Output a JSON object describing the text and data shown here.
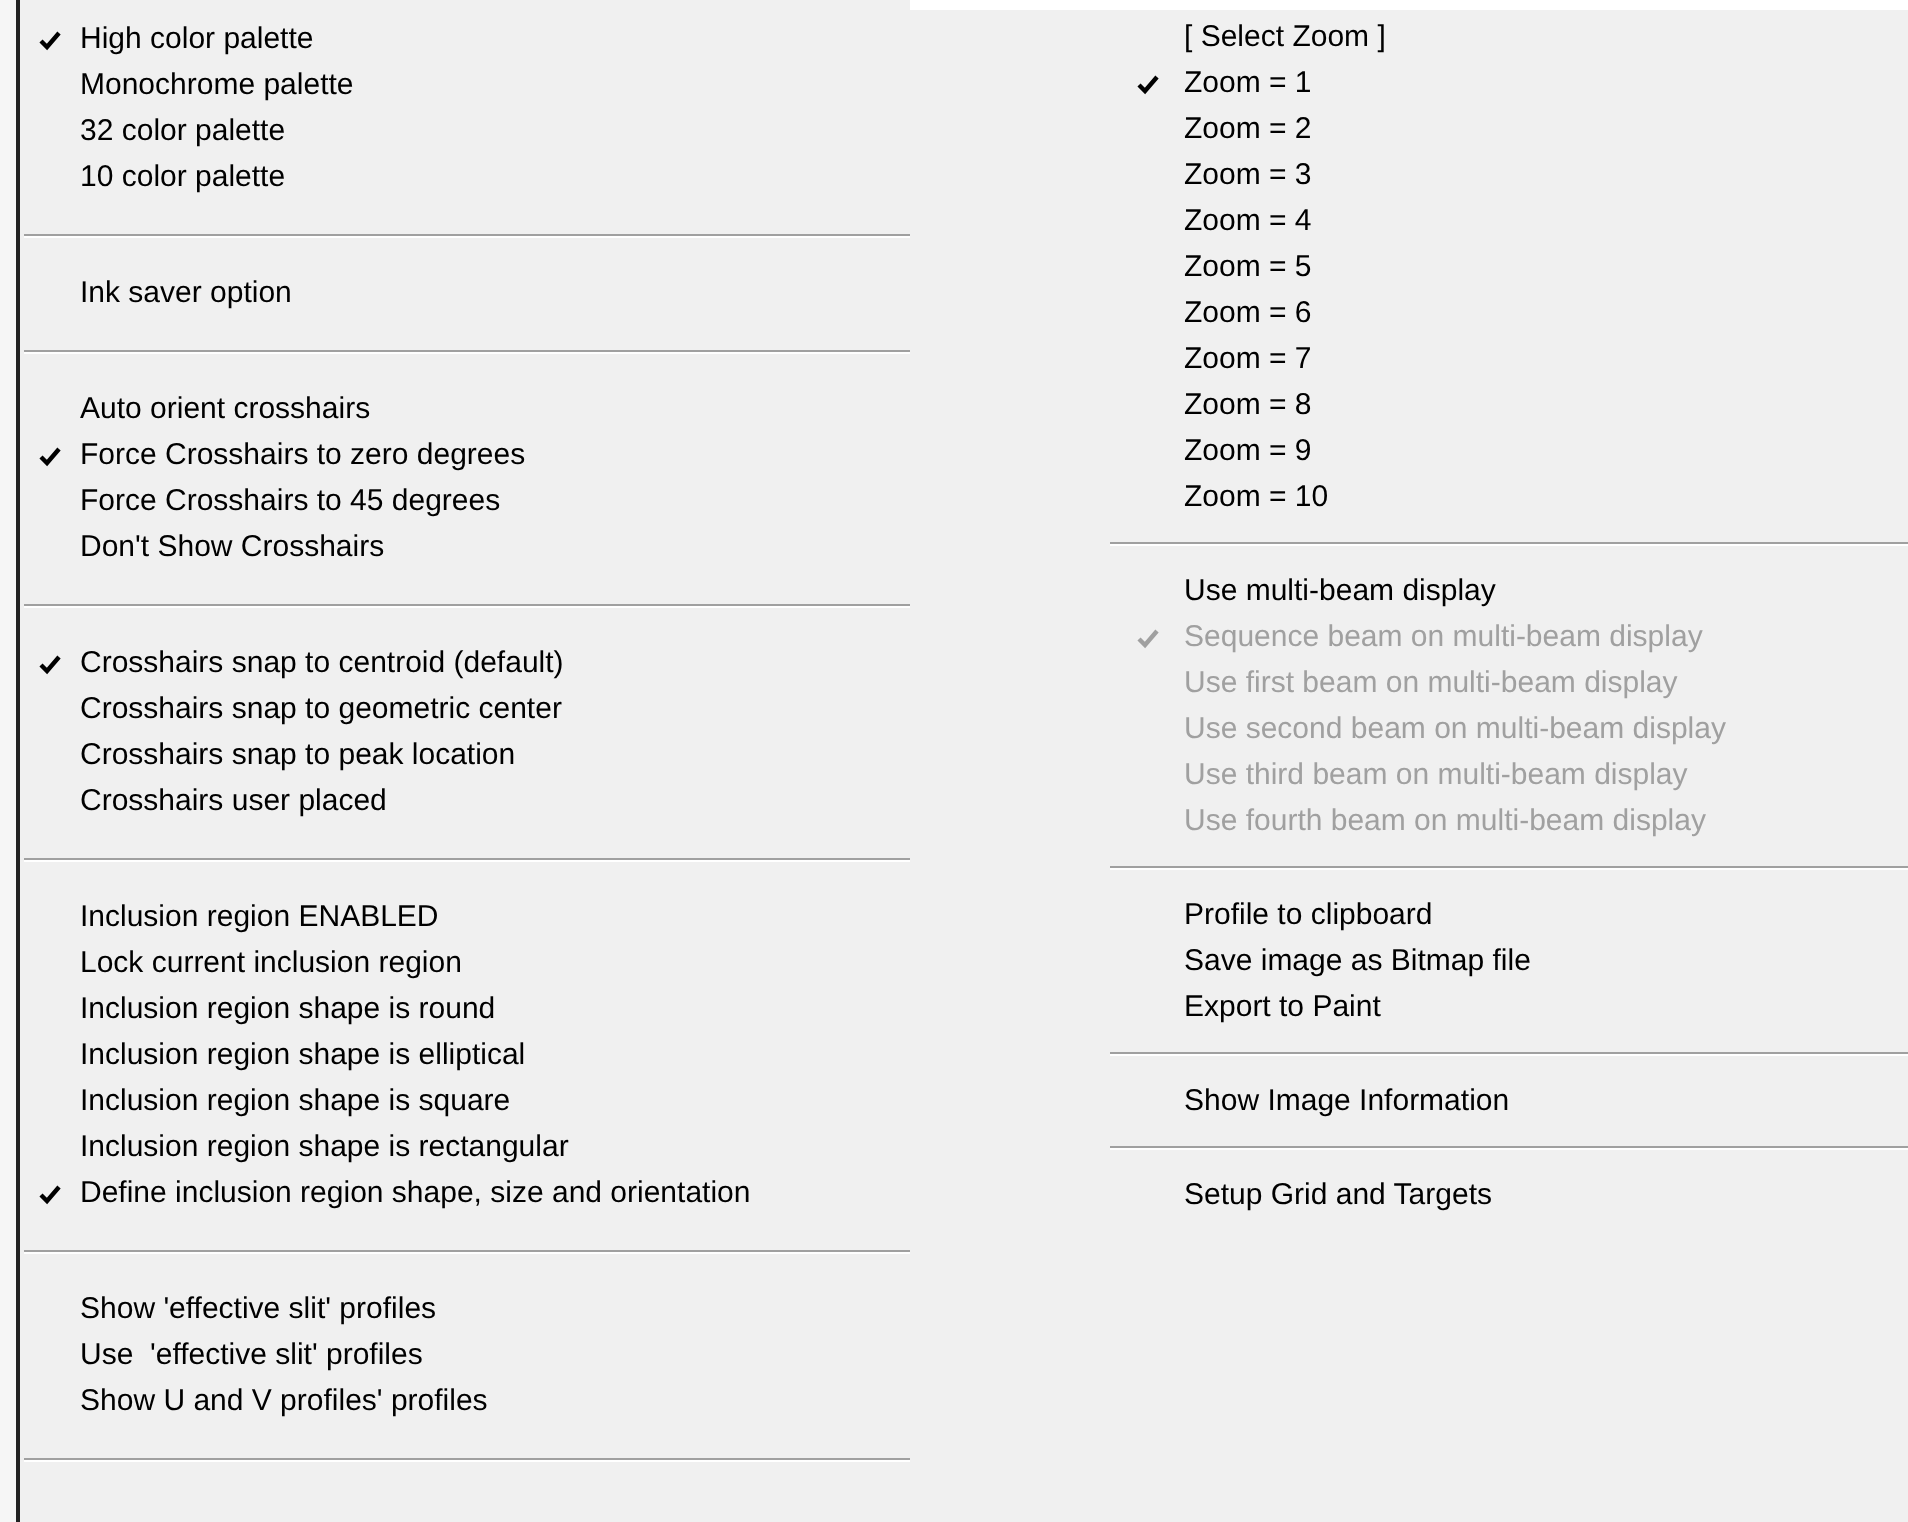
{
  "left_menu": {
    "sections": [
      {
        "items": [
          {
            "label": "High color palette",
            "checked": true,
            "disabled": false
          },
          {
            "label": "Monochrome palette",
            "checked": false,
            "disabled": false
          },
          {
            "label": "32 color palette",
            "checked": false,
            "disabled": false
          },
          {
            "label": "10 color palette",
            "checked": false,
            "disabled": false
          }
        ]
      },
      {
        "items": [
          {
            "label": "Ink saver option",
            "checked": false,
            "disabled": false
          }
        ]
      },
      {
        "items": [
          {
            "label": "Auto orient crosshairs",
            "checked": false,
            "disabled": false
          },
          {
            "label": "Force Crosshairs to zero degrees",
            "checked": true,
            "disabled": false
          },
          {
            "label": "Force Crosshairs to 45 degrees",
            "checked": false,
            "disabled": false
          },
          {
            "label": "Don't Show Crosshairs",
            "checked": false,
            "disabled": false
          }
        ]
      },
      {
        "items": [
          {
            "label": "Crosshairs snap to centroid (default)",
            "checked": true,
            "disabled": false
          },
          {
            "label": "Crosshairs snap to geometric center",
            "checked": false,
            "disabled": false
          },
          {
            "label": "Crosshairs snap to peak location",
            "checked": false,
            "disabled": false
          },
          {
            "label": "Crosshairs user placed",
            "checked": false,
            "disabled": false
          }
        ]
      },
      {
        "items": [
          {
            "label": "Inclusion region ENABLED",
            "checked": false,
            "disabled": false
          },
          {
            "label": "Lock current inclusion region",
            "checked": false,
            "disabled": false
          },
          {
            "label": "Inclusion region shape is round",
            "checked": false,
            "disabled": false
          },
          {
            "label": "Inclusion region shape is elliptical",
            "checked": false,
            "disabled": false
          },
          {
            "label": "Inclusion region shape is square",
            "checked": false,
            "disabled": false
          },
          {
            "label": "Inclusion region shape is rectangular",
            "checked": false,
            "disabled": false
          },
          {
            "label": "Define inclusion region shape, size and orientation",
            "checked": true,
            "disabled": false
          }
        ]
      },
      {
        "items": [
          {
            "label": "Show 'effective slit' profiles",
            "checked": false,
            "disabled": false
          },
          {
            "label": "Use  'effective slit' profiles",
            "checked": false,
            "disabled": false
          },
          {
            "label": "Show U and V profiles' profiles",
            "checked": false,
            "disabled": false
          }
        ],
        "divider_below": true
      }
    ]
  },
  "right_menu": {
    "sections": [
      {
        "items": [
          {
            "label": "[ Select Zoom ]",
            "checked": false,
            "disabled": false
          },
          {
            "label": "Zoom = 1",
            "checked": true,
            "disabled": false
          },
          {
            "label": "Zoom = 2",
            "checked": false,
            "disabled": false
          },
          {
            "label": "Zoom = 3",
            "checked": false,
            "disabled": false
          },
          {
            "label": "Zoom = 4",
            "checked": false,
            "disabled": false
          },
          {
            "label": "Zoom = 5",
            "checked": false,
            "disabled": false
          },
          {
            "label": "Zoom = 6",
            "checked": false,
            "disabled": false
          },
          {
            "label": "Zoom = 7",
            "checked": false,
            "disabled": false
          },
          {
            "label": "Zoom = 8",
            "checked": false,
            "disabled": false
          },
          {
            "label": "Zoom = 9",
            "checked": false,
            "disabled": false
          },
          {
            "label": "Zoom = 10",
            "checked": false,
            "disabled": false
          }
        ]
      },
      {
        "items": [
          {
            "label": "Use multi-beam display",
            "checked": false,
            "disabled": false
          },
          {
            "label": "Sequence beam on multi-beam display",
            "checked": true,
            "disabled": true
          },
          {
            "label": "Use first beam on multi-beam display",
            "checked": false,
            "disabled": true
          },
          {
            "label": "Use second beam on multi-beam display",
            "checked": false,
            "disabled": true
          },
          {
            "label": "Use third beam on multi-beam display",
            "checked": false,
            "disabled": true
          },
          {
            "label": "Use fourth beam on multi-beam display",
            "checked": false,
            "disabled": true
          }
        ]
      },
      {
        "items": [
          {
            "label": "Profile to clipboard",
            "checked": false,
            "disabled": false
          },
          {
            "label": "Save image as Bitmap file",
            "checked": false,
            "disabled": false
          },
          {
            "label": "Export to Paint",
            "checked": false,
            "disabled": false
          }
        ]
      },
      {
        "items": [
          {
            "label": "Show Image Information",
            "checked": false,
            "disabled": false
          }
        ]
      },
      {
        "items": [
          {
            "label": "Setup Grid and Targets",
            "checked": false,
            "disabled": false
          }
        ]
      }
    ]
  }
}
